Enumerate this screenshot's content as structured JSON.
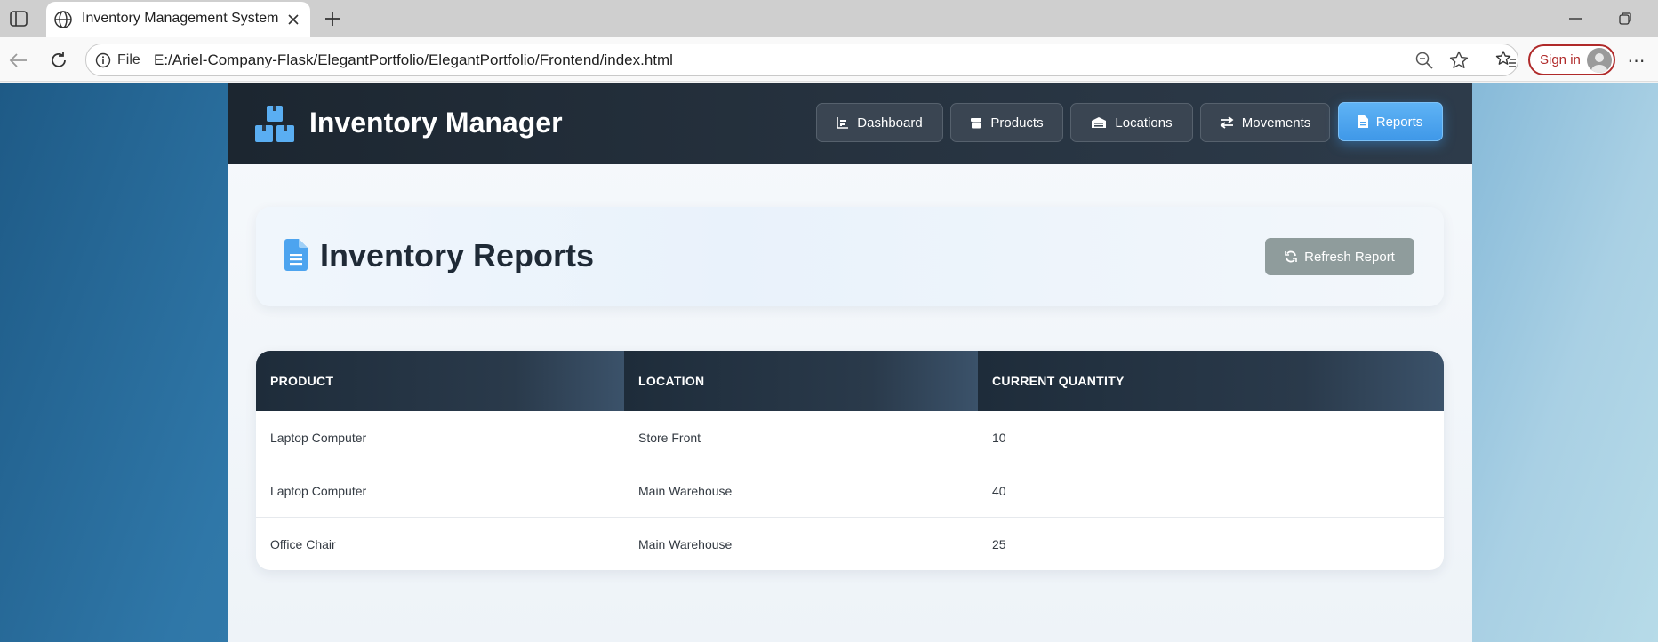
{
  "browser": {
    "tab_title": "Inventory Management System",
    "scheme_label": "File",
    "url": "E:/Ariel-Company-Flask/ElegantPortfolio/ElegantPortfolio/Frontend/index.html",
    "sign_in_label": "Sign in"
  },
  "navbar": {
    "brand": "Inventory Manager",
    "items": [
      {
        "label": "Dashboard",
        "icon": "chart-icon"
      },
      {
        "label": "Products",
        "icon": "box-icon"
      },
      {
        "label": "Locations",
        "icon": "warehouse-icon"
      },
      {
        "label": "Movements",
        "icon": "exchange-icon"
      },
      {
        "label": "Reports",
        "icon": "file-icon",
        "active": true
      }
    ]
  },
  "page": {
    "title": "Inventory Reports",
    "refresh_label": "Refresh Report"
  },
  "table": {
    "columns": [
      "PRODUCT",
      "LOCATION",
      "CURRENT QUANTITY"
    ],
    "rows": [
      [
        "Laptop Computer",
        "Store Front",
        "10"
      ],
      [
        "Laptop Computer",
        "Main Warehouse",
        "40"
      ],
      [
        "Office Chair",
        "Main Warehouse",
        "25"
      ]
    ]
  },
  "colors": {
    "navbar_dark": "#1c2630",
    "active_nav": "#4aa3ee",
    "refresh_button": "#8f9c9c",
    "brand_icon": "#5aaef2",
    "sign_in_red": "#b02a2a"
  }
}
